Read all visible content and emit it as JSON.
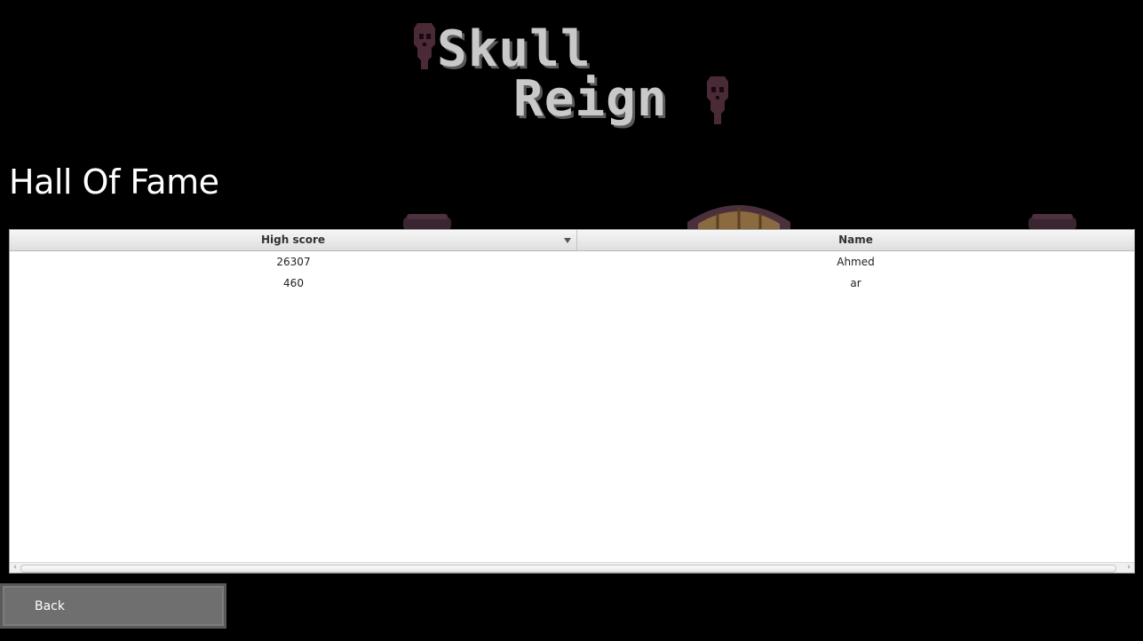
{
  "logo": {
    "line1": "Skull",
    "line2": "Reign"
  },
  "page": {
    "title": "Hall Of Fame"
  },
  "table": {
    "columns": [
      {
        "label": "High score",
        "sorted": "descending"
      },
      {
        "label": "Name"
      }
    ],
    "rows": [
      {
        "score": "26307",
        "name": "Ahmed"
      },
      {
        "score": "460",
        "name": "ar"
      }
    ],
    "scroll_left": "‹",
    "scroll_right": "›"
  },
  "buttons": {
    "back_label": "Back"
  },
  "colors": {
    "background": "#000000",
    "logo_text": "#c9c9c9",
    "skull": "#4a2a36",
    "button": "#6f6f6f"
  }
}
